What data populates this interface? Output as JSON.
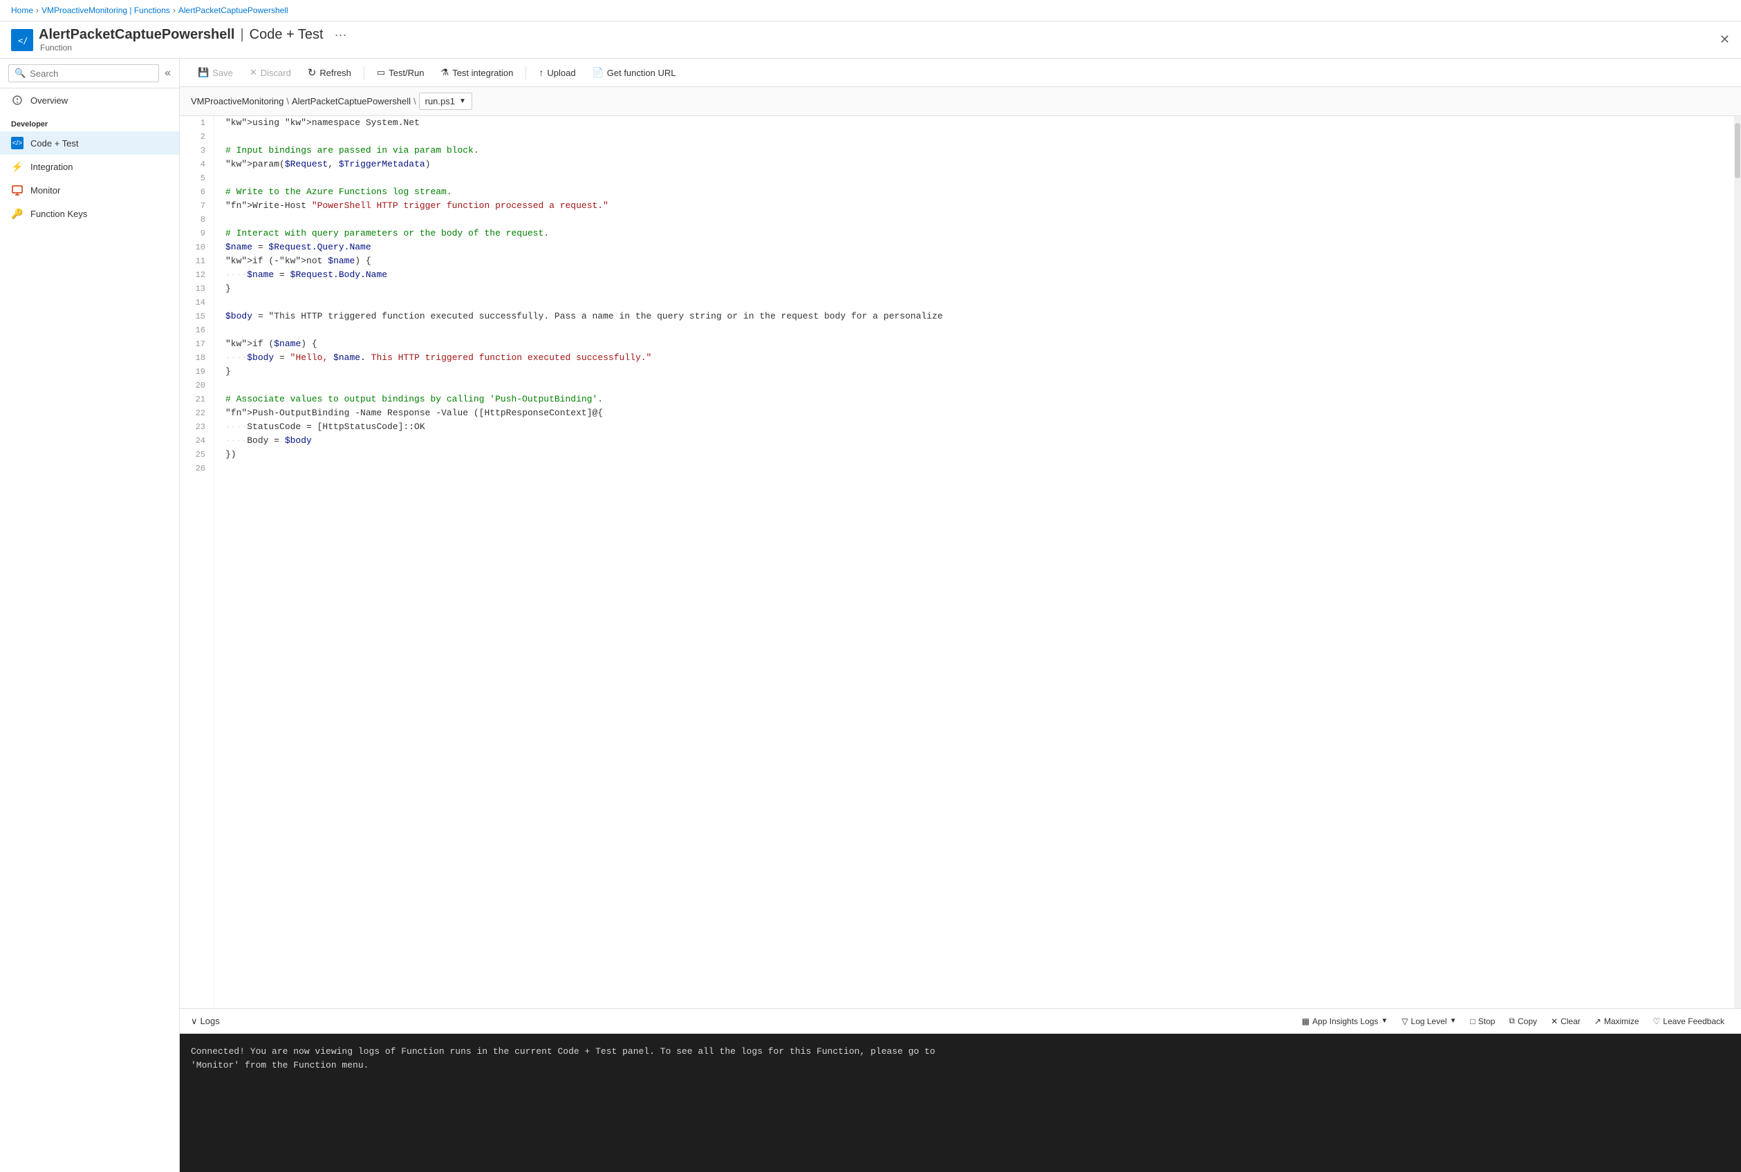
{
  "breadcrumb": {
    "items": [
      "Home",
      "VMProactiveMonitoring | Functions",
      "AlertPacketCaptuePowershell"
    ]
  },
  "header": {
    "title": "AlertPacketCaptuePowershell",
    "separator": "|",
    "subtitle": "Code + Test",
    "dots": "···",
    "function_label": "Function",
    "close_label": "✕"
  },
  "sidebar": {
    "search_placeholder": "Search",
    "collapse_icon": "«",
    "overview_label": "Overview",
    "section_developer": "Developer",
    "items": [
      {
        "id": "code-test",
        "label": "Code + Test",
        "icon": "💻",
        "active": true
      },
      {
        "id": "integration",
        "label": "Integration",
        "icon": "⚡"
      },
      {
        "id": "monitor",
        "label": "Monitor",
        "icon": "📊"
      },
      {
        "id": "function-keys",
        "label": "Function Keys",
        "icon": "🔑"
      }
    ]
  },
  "toolbar": {
    "buttons": [
      {
        "id": "save",
        "label": "Save",
        "icon": "💾",
        "disabled": true
      },
      {
        "id": "discard",
        "label": "Discard",
        "icon": "✕",
        "disabled": true
      },
      {
        "id": "refresh",
        "label": "Refresh",
        "icon": "↻",
        "disabled": false
      },
      {
        "id": "test-run",
        "label": "Test/Run",
        "icon": "▭",
        "disabled": false
      },
      {
        "id": "test-integration",
        "label": "Test integration",
        "icon": "⚗",
        "disabled": false
      },
      {
        "id": "upload",
        "label": "Upload",
        "icon": "↑",
        "disabled": false
      },
      {
        "id": "get-function-url",
        "label": "Get function URL",
        "icon": "📄",
        "disabled": false
      }
    ]
  },
  "editor_path": {
    "parts": [
      "VMProactiveMonitoring",
      "\\",
      "AlertPacketCaptuePowershell",
      "\\"
    ],
    "file": "run.ps1"
  },
  "code_lines": [
    {
      "num": 1,
      "text": "using namespace System.Net"
    },
    {
      "num": 2,
      "text": ""
    },
    {
      "num": 3,
      "text": "# Input bindings are passed in via param block."
    },
    {
      "num": 4,
      "text": "param($Request, $TriggerMetadata)"
    },
    {
      "num": 5,
      "text": ""
    },
    {
      "num": 6,
      "text": "# Write to the Azure Functions log stream."
    },
    {
      "num": 7,
      "text": "Write-Host \"PowerShell HTTP trigger function processed a request.\""
    },
    {
      "num": 8,
      "text": ""
    },
    {
      "num": 9,
      "text": "# Interact with query parameters or the body of the request."
    },
    {
      "num": 10,
      "text": "$name = $Request.Query.Name"
    },
    {
      "num": 11,
      "text": "if (-not $name) {"
    },
    {
      "num": 12,
      "text": "    $name = $Request.Body.Name"
    },
    {
      "num": 13,
      "text": "}"
    },
    {
      "num": 14,
      "text": ""
    },
    {
      "num": 15,
      "text": "$body = \"This HTTP triggered function executed successfully. Pass a name in the query string or in the request body for a personalize"
    },
    {
      "num": 16,
      "text": ""
    },
    {
      "num": 17,
      "text": "if ($name) {"
    },
    {
      "num": 18,
      "text": "    $body = \"Hello, $name. This HTTP triggered function executed successfully.\""
    },
    {
      "num": 19,
      "text": "}"
    },
    {
      "num": 20,
      "text": ""
    },
    {
      "num": 21,
      "text": "# Associate values to output bindings by calling 'Push-OutputBinding'."
    },
    {
      "num": 22,
      "text": "Push-OutputBinding -Name Response -Value ([HttpResponseContext]@{"
    },
    {
      "num": 23,
      "text": "    StatusCode = [HttpStatusCode]::OK"
    },
    {
      "num": 24,
      "text": "    Body = $body"
    },
    {
      "num": 25,
      "text": "})"
    },
    {
      "num": 26,
      "text": ""
    }
  ],
  "logs": {
    "title": "Logs",
    "chevron": "∨",
    "app_insights": "App Insights Logs",
    "log_level": "Log Level",
    "stop": "Stop",
    "copy": "Copy",
    "clear": "Clear",
    "maximize": "Maximize",
    "leave_feedback": "Leave Feedback",
    "console_message": "Connected! You are now viewing logs of Function runs in the current Code + Test panel. To see all the logs for this Function, please go to\n'Monitor' from the Function menu."
  }
}
